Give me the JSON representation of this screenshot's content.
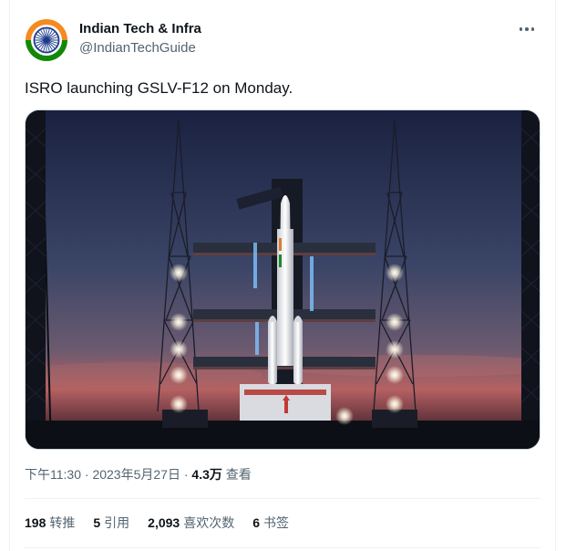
{
  "tweet": {
    "display_name": "Indian Tech & Infra",
    "handle": "@IndianTechGuide",
    "text": "ISRO launching GSLV-F12 on Monday.",
    "time": "下午11:30",
    "date": "2023年5月27日",
    "separator": "·",
    "views_count": "4.3万",
    "views_label": "查看",
    "stats": [
      {
        "count": "198",
        "label": "转推"
      },
      {
        "count": "5",
        "label": "引用"
      },
      {
        "count": "2,093",
        "label": "喜欢次数"
      },
      {
        "count": "6",
        "label": "书签"
      }
    ]
  },
  "media": {
    "subject": "rocket-launch-pad-photo",
    "colors": {
      "sky_top": "#1c2440",
      "sky_mid": "#3b4566",
      "horizon": "#b86060",
      "ground": "#0c0e14"
    }
  },
  "avatar": {
    "icon": "ashoka-chakra-icon",
    "colors": {
      "saffron": "#f58a1f",
      "green": "#138808",
      "navy": "#1b3a8a"
    }
  },
  "colors": {
    "text": "#0f1419",
    "muted": "#536471",
    "border": "#eff3f4"
  }
}
